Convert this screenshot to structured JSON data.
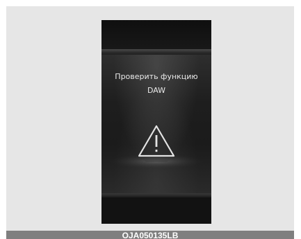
{
  "display": {
    "message_line1": "Проверить функцию",
    "message_line2": "DAW",
    "icon": "warning-triangle-icon"
  },
  "caption": {
    "code": "OJA050135LB"
  },
  "colors": {
    "frame_background": "#e6e6e6",
    "display_background": "#151515",
    "text": "#e9e9e9",
    "caption_bar": "#7f7f7f"
  }
}
